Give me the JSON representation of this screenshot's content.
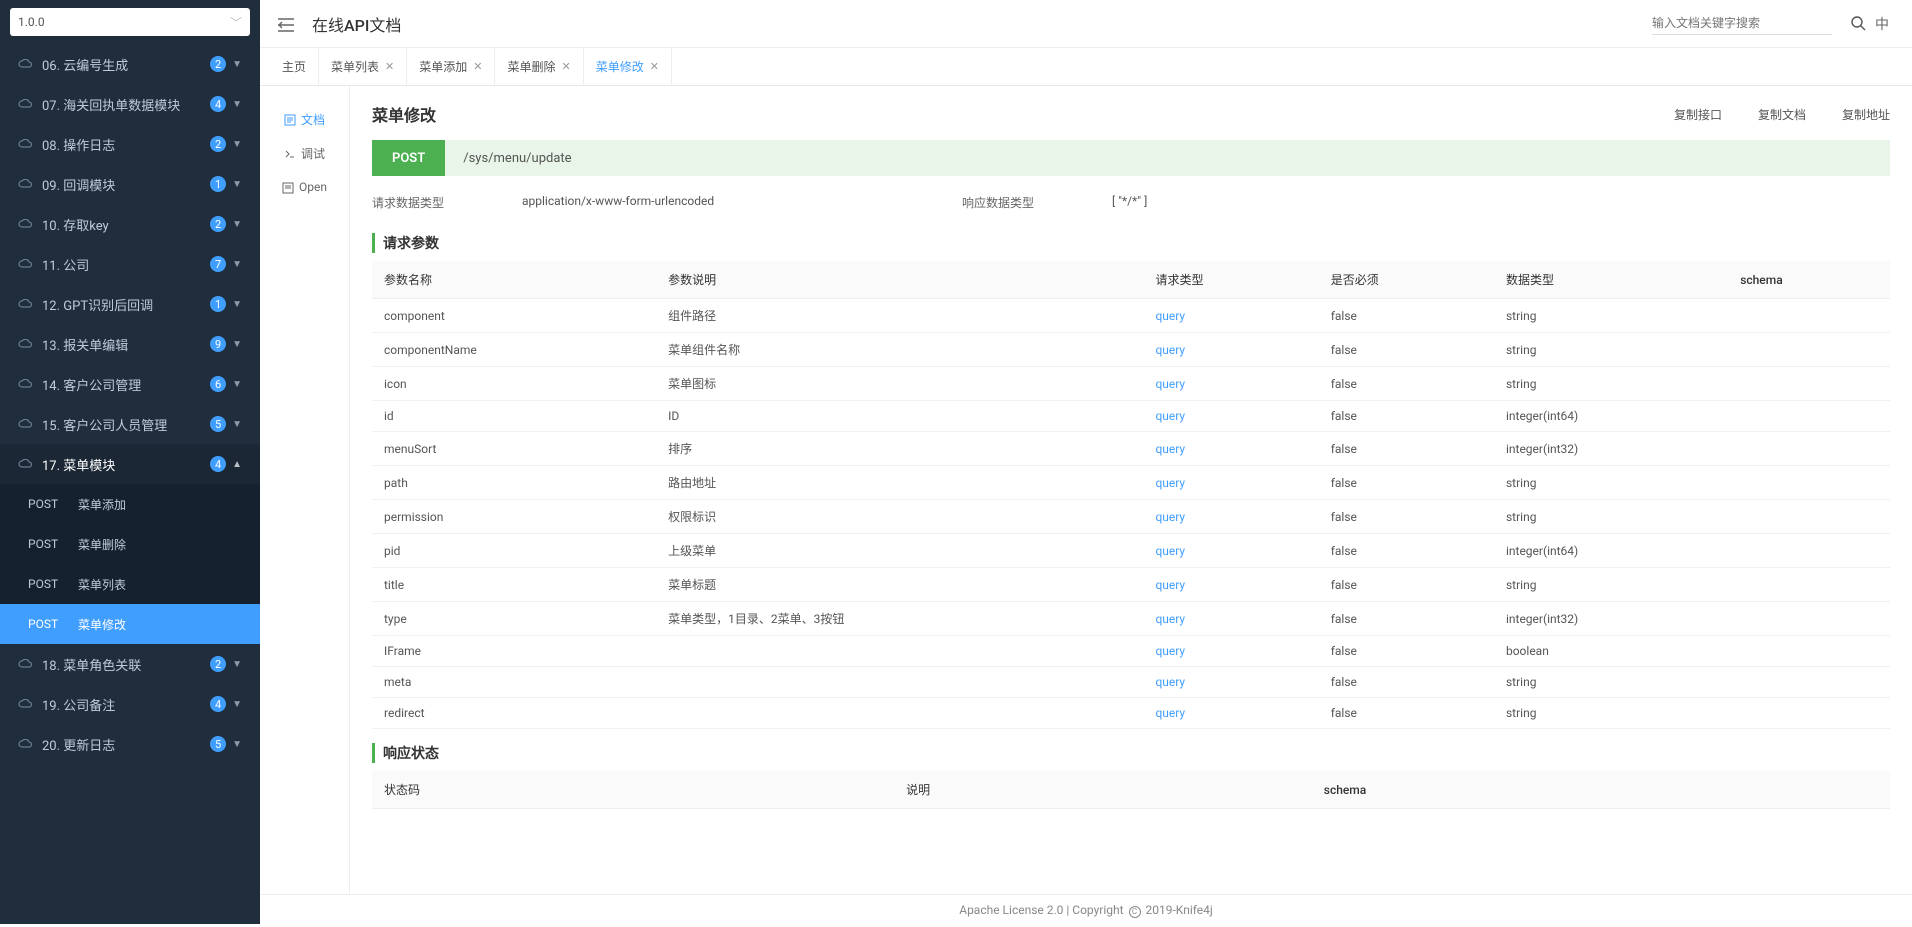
{
  "version": "1.0.0",
  "header": {
    "title": "在线API文档",
    "search_placeholder": "输入文档关键字搜索",
    "lang": "中"
  },
  "sidebar": {
    "items": [
      {
        "label": "06. 云编号生成",
        "badge": "2"
      },
      {
        "label": "07. 海关回执单数据模块",
        "badge": "4"
      },
      {
        "label": "08. 操作日志",
        "badge": "2"
      },
      {
        "label": "09. 回调模块",
        "badge": "1"
      },
      {
        "label": "10. 存取key",
        "badge": "2"
      },
      {
        "label": "11. 公司",
        "badge": "7"
      },
      {
        "label": "12. GPT识别后回调",
        "badge": "1"
      },
      {
        "label": "13. 报关单编辑",
        "badge": "9"
      },
      {
        "label": "14. 客户公司管理",
        "badge": "6"
      },
      {
        "label": "15. 客户公司人员管理",
        "badge": "5"
      },
      {
        "label": "17. 菜单模块",
        "badge": "4"
      },
      {
        "label": "18. 菜单角色关联",
        "badge": "2"
      },
      {
        "label": "19. 公司备注",
        "badge": "4"
      },
      {
        "label": "20. 更新日志",
        "badge": "5"
      }
    ],
    "sub": [
      {
        "method": "POST",
        "label": "菜单添加"
      },
      {
        "method": "POST",
        "label": "菜单删除"
      },
      {
        "method": "POST",
        "label": "菜单列表"
      },
      {
        "method": "POST",
        "label": "菜单修改"
      }
    ]
  },
  "tabs": [
    {
      "label": "主页",
      "closable": false
    },
    {
      "label": "菜单列表",
      "closable": true
    },
    {
      "label": "菜单添加",
      "closable": true
    },
    {
      "label": "菜单删除",
      "closable": true
    },
    {
      "label": "菜单修改",
      "closable": true,
      "active": true
    }
  ],
  "leftnav": [
    {
      "label": "文档",
      "active": true
    },
    {
      "label": "调试"
    },
    {
      "label": "Open"
    }
  ],
  "doc": {
    "title": "菜单修改",
    "actions": [
      "复制接口",
      "复制文档",
      "复制地址"
    ],
    "method": "POST",
    "path": "/sys/menu/update",
    "reqTypeLabel": "请求数据类型",
    "reqType": "application/x-www-form-urlencoded",
    "resTypeLabel": "响应数据类型",
    "resType": "[ \"*/*\" ]",
    "sections": {
      "request": "请求参数",
      "response": "响应状态"
    },
    "paramHeaders": [
      "参数名称",
      "参数说明",
      "请求类型",
      "是否必须",
      "数据类型",
      "schema"
    ],
    "params": [
      {
        "name": "component",
        "desc": "组件路径",
        "rt": "query",
        "req": "false",
        "dt": "string",
        "sc": ""
      },
      {
        "name": "componentName",
        "desc": "菜单组件名称",
        "rt": "query",
        "req": "false",
        "dt": "string",
        "sc": ""
      },
      {
        "name": "icon",
        "desc": "菜单图标",
        "rt": "query",
        "req": "false",
        "dt": "string",
        "sc": ""
      },
      {
        "name": "id",
        "desc": "ID",
        "rt": "query",
        "req": "false",
        "dt": "integer(int64)",
        "sc": ""
      },
      {
        "name": "menuSort",
        "desc": "排序",
        "rt": "query",
        "req": "false",
        "dt": "integer(int32)",
        "sc": ""
      },
      {
        "name": "path",
        "desc": "路由地址",
        "rt": "query",
        "req": "false",
        "dt": "string",
        "sc": ""
      },
      {
        "name": "permission",
        "desc": "权限标识",
        "rt": "query",
        "req": "false",
        "dt": "string",
        "sc": ""
      },
      {
        "name": "pid",
        "desc": "上级菜单",
        "rt": "query",
        "req": "false",
        "dt": "integer(int64)",
        "sc": ""
      },
      {
        "name": "title",
        "desc": "菜单标题",
        "rt": "query",
        "req": "false",
        "dt": "string",
        "sc": ""
      },
      {
        "name": "type",
        "desc": "菜单类型，1目录、2菜单、3按钮",
        "rt": "query",
        "req": "false",
        "dt": "integer(int32)",
        "sc": ""
      },
      {
        "name": "IFrame",
        "desc": "",
        "rt": "query",
        "req": "false",
        "dt": "boolean",
        "sc": ""
      },
      {
        "name": "meta",
        "desc": "",
        "rt": "query",
        "req": "false",
        "dt": "string",
        "sc": ""
      },
      {
        "name": "redirect",
        "desc": "",
        "rt": "query",
        "req": "false",
        "dt": "string",
        "sc": ""
      }
    ],
    "respHeaders": [
      "状态码",
      "说明",
      "schema"
    ]
  },
  "footer": {
    "text1": "Apache License 2.0 | Copyright ",
    "text2": " 2019-Knife4j",
    "c": "C"
  }
}
